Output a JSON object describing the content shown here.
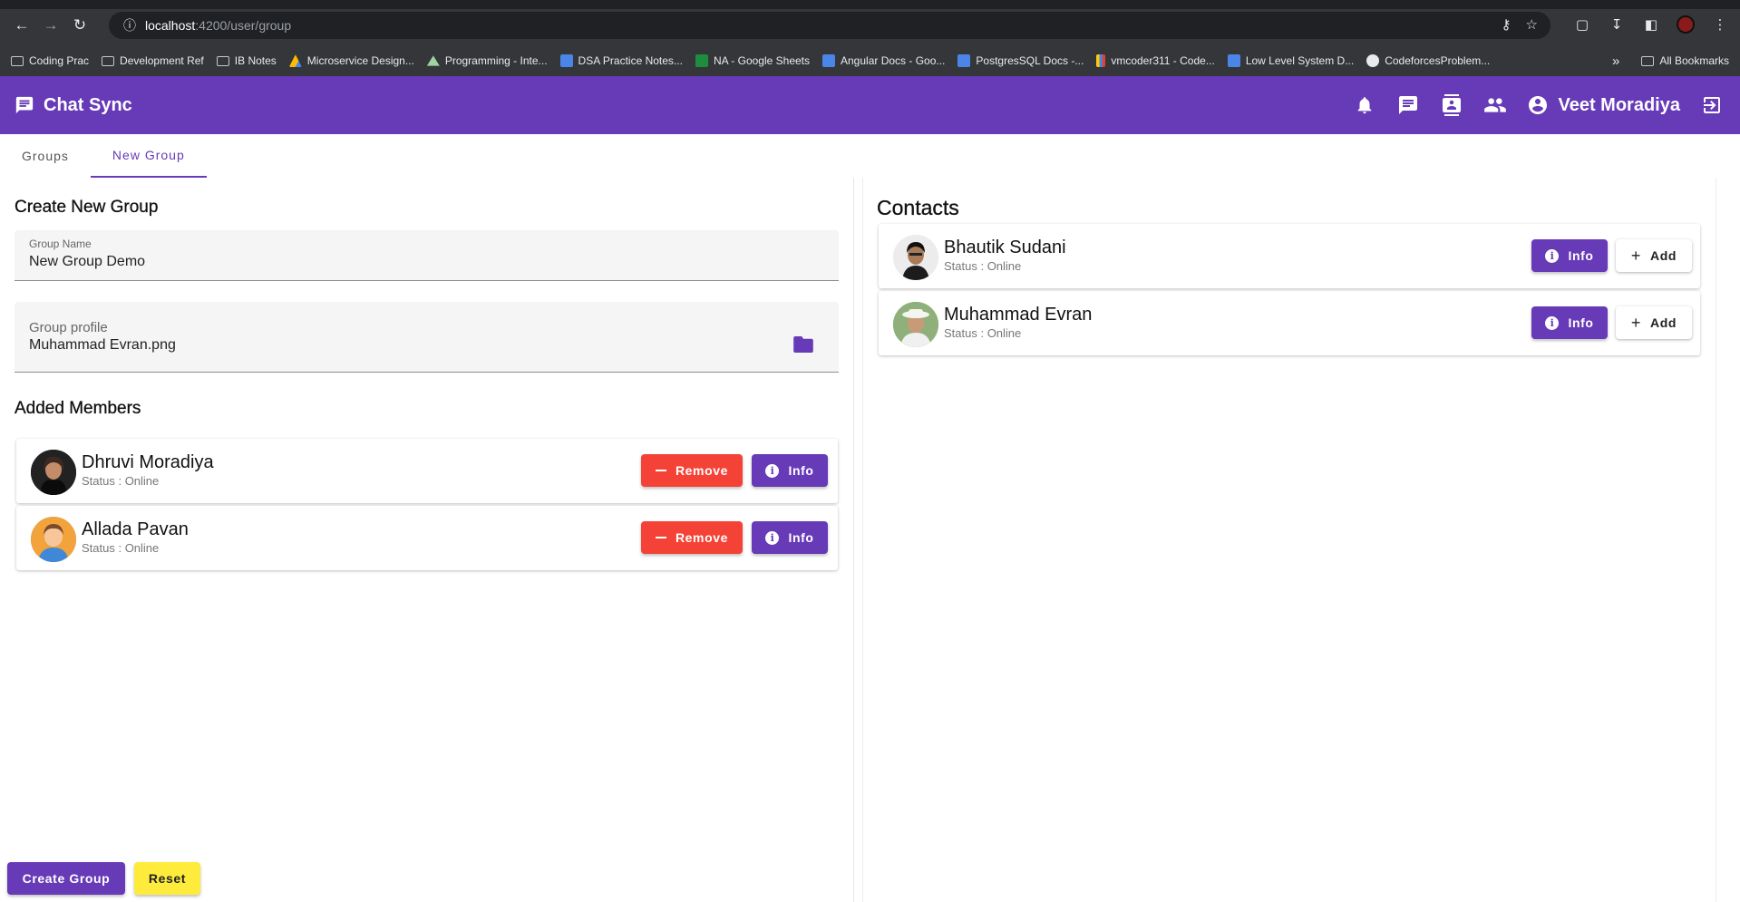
{
  "browser": {
    "url_host": "localhost",
    "url_path": ":4200/user/group",
    "bookmarks": [
      {
        "label": "Coding Prac",
        "icon": "folder-icon"
      },
      {
        "label": "Development Ref",
        "icon": "folder-icon"
      },
      {
        "label": "IB Notes",
        "icon": "folder-icon"
      },
      {
        "label": "Microservice Design...",
        "icon": "drive-icon"
      },
      {
        "label": "Programming - Inte...",
        "icon": "triangle-icon"
      },
      {
        "label": "DSA Practice Notes...",
        "icon": "doc-icon"
      },
      {
        "label": "NA - Google Sheets",
        "icon": "sheet-icon"
      },
      {
        "label": "Angular Docs - Goo...",
        "icon": "doc-icon"
      },
      {
        "label": "PostgresSQL Docs -...",
        "icon": "doc-icon"
      },
      {
        "label": "vmcoder311 - Code...",
        "icon": "bars-icon"
      },
      {
        "label": "Low Level System D...",
        "icon": "doc-icon"
      },
      {
        "label": "CodeforcesProblem...",
        "icon": "globe-icon"
      }
    ],
    "all_bookmarks": "All Bookmarks",
    "overflow": "»"
  },
  "app": {
    "title": "Chat Sync",
    "user_name": "Veet Moradiya",
    "accent": "#673ab7"
  },
  "tabs": [
    {
      "label": "Groups",
      "active": false
    },
    {
      "label": "New Group",
      "active": true
    }
  ],
  "create": {
    "heading": "Create New Group",
    "group_name_label": "Group Name",
    "group_name_value": "New Group Demo",
    "profile_label": "Group profile",
    "profile_value": "Muhammad Evran.png",
    "members_heading": "Added Members",
    "members": [
      {
        "name": "Dhruvi Moradiya",
        "status": "Status : Online",
        "remove": "Remove",
        "info": "Info"
      },
      {
        "name": "Allada Pavan",
        "status": "Status : Online",
        "remove": "Remove",
        "info": "Info"
      }
    ],
    "create_button": "Create Group",
    "reset_button": "Reset"
  },
  "contacts": {
    "heading": "Contacts",
    "items": [
      {
        "name": "Bhautik Sudani",
        "status": "Status : Online",
        "info": "Info",
        "add": "Add"
      },
      {
        "name": "Muhammad Evran",
        "status": "Status : Online",
        "info": "Info",
        "add": "Add"
      }
    ]
  }
}
